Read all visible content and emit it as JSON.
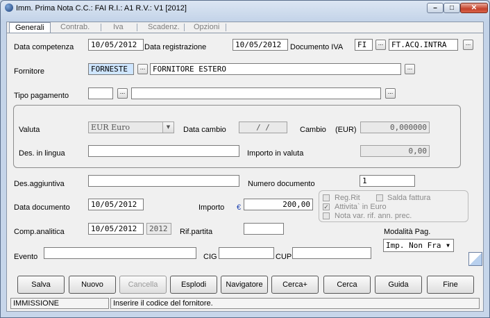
{
  "window": {
    "title": "Imm. Prima Nota C.C.: FAI  R.I.: A1  R.V.: V1  [2012]",
    "min": "–",
    "max": "□",
    "close": "✕"
  },
  "tabs": [
    "Generali",
    "Contrab.",
    "Iva",
    "Scadenz.",
    "Opzioni"
  ],
  "labels": {
    "data_competenza": "Data competenza",
    "data_registrazione": "Data registrazione",
    "documento_iva": "Documento IVA",
    "fornitore": "Fornitore",
    "tipo_pagamento": "Tipo pagamento",
    "valuta": "Valuta",
    "data_cambio": "Data cambio",
    "cambio": "Cambio",
    "eur": "(EUR)",
    "des_lingua": "Des. in lingua",
    "importo_valuta": "Importo in valuta",
    "des_aggiuntiva": "Des.aggiuntiva",
    "numero_documento": "Numero documento",
    "data_documento": "Data documento",
    "importo": "Importo",
    "comp_analitica": "Comp.analitica",
    "rif_partita": "Rif.partita",
    "modalita_pag": "Modalità Pag.",
    "evento": "Evento",
    "cig": "CIG",
    "cup": "CUP",
    "reg_rit": "Reg.Rit",
    "saldo_fattura": "Salda fattura",
    "attivita_euro": "Attivita` in Euro",
    "nota_var": "Nota var. rif. ann. prec.",
    "euro_sign": "€",
    "ellipsis": "..."
  },
  "values": {
    "data_competenza": "10/05/2012",
    "data_registrazione": "10/05/2012",
    "doc_iva_code": "FI",
    "doc_iva_desc": "FT.ACQ.INTRA",
    "fornitore_code": "FORNESTE",
    "fornitore_desc": "FORNITORE ESTERO",
    "tipo_pagamento_code": "",
    "tipo_pagamento_desc": "",
    "valuta": "EUR Euro",
    "data_cambio": " /  /",
    "cambio": "0,000000",
    "des_lingua": "",
    "importo_valuta": "0,00",
    "des_aggiuntiva": "",
    "numero_documento": "1",
    "data_documento": "10/05/2012",
    "importo": "200,00",
    "comp_analitica": "10/05/2012",
    "comp_anno": "2012",
    "rif_partita": "",
    "modalita_pag": "Imp. Non Fra",
    "evento": "",
    "cig": "",
    "cup": ""
  },
  "checkboxes": {
    "reg_rit": false,
    "saldo_fattura": false,
    "attivita_euro": true,
    "nota_var": false
  },
  "buttons": [
    "Salva",
    "Nuovo",
    "Cancella",
    "Esplodi",
    "Navigatore",
    "Cerca+",
    "Cerca",
    "Guida",
    "Fine"
  ],
  "status": {
    "mode": "IMMISSIONE",
    "message": "Inserire il codice del fornitore."
  }
}
